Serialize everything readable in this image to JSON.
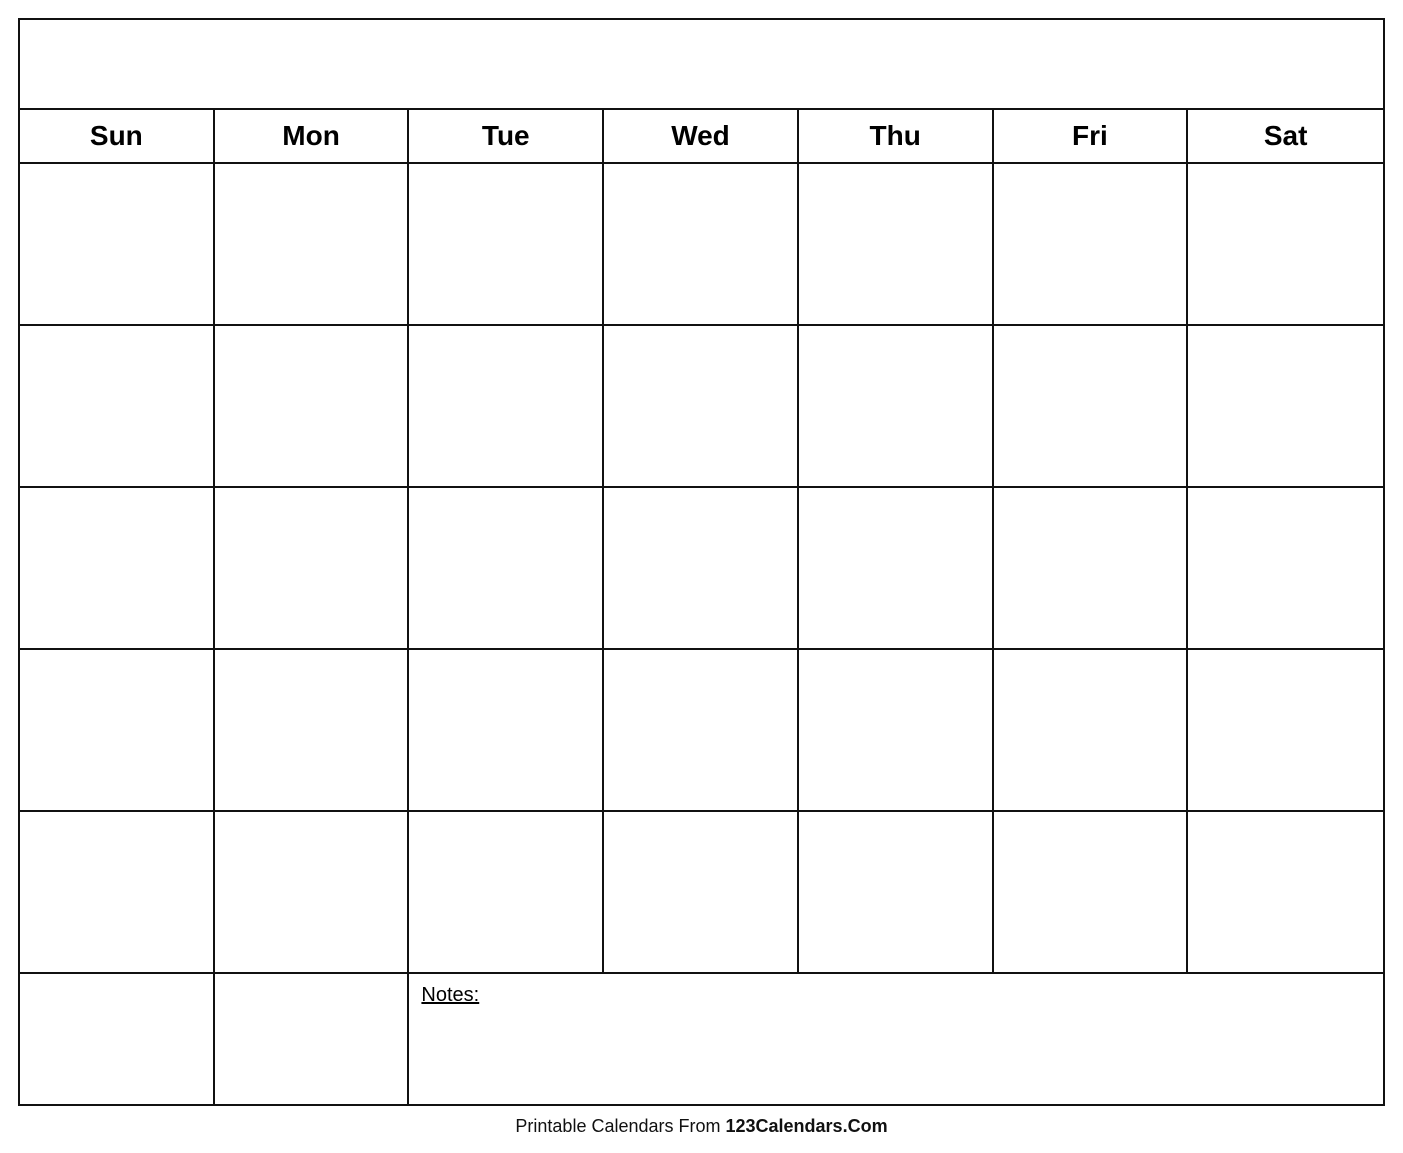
{
  "calendar": {
    "title": "",
    "days": [
      "Sun",
      "Mon",
      "Tue",
      "Wed",
      "Thu",
      "Fri",
      "Sat"
    ],
    "rows": 5,
    "notes_label": "Notes:"
  },
  "footer": {
    "prefix": "Printable Calendars From ",
    "brand": "123Calendars.Com"
  }
}
